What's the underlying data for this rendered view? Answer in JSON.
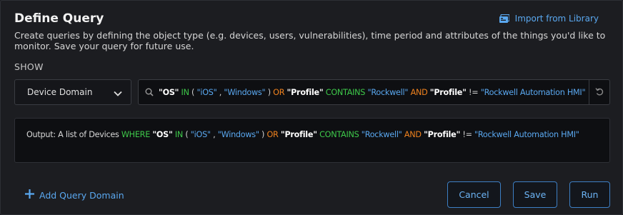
{
  "header": {
    "title": "Define Query",
    "import_label": "Import from Library"
  },
  "description": "Create queries by defining the object type (e.g. devices, users, vulnerabilities), time period and attributes of the things you'd like to monitor. Save your query for future use.",
  "show": {
    "label": "SHOW",
    "selected": "Device Domain"
  },
  "query": {
    "tokens": [
      {
        "t": "\"OS\"",
        "k": "field"
      },
      {
        "t": " IN ",
        "k": "in"
      },
      {
        "t": "( ",
        "k": "paren"
      },
      {
        "t": "\"iOS\"",
        "k": "str"
      },
      {
        "t": " , ",
        "k": "paren"
      },
      {
        "t": "\"Windows\"",
        "k": "str"
      },
      {
        "t": " )  ",
        "k": "paren"
      },
      {
        "t": "OR ",
        "k": "logic"
      },
      {
        "t": "\"Profile\"",
        "k": "field"
      },
      {
        "t": " CONTAINS ",
        "k": "op"
      },
      {
        "t": "\"Rockwell\"",
        "k": "str"
      },
      {
        "t": " AND ",
        "k": "logic"
      },
      {
        "t": "\"Profile\"",
        "k": "field"
      },
      {
        "t": " != ",
        "k": "neq"
      },
      {
        "t": "\"Rockwell Automation HMI\"",
        "k": "str"
      }
    ]
  },
  "output": {
    "prefix": "Output: A list of Devices ",
    "where": "WHERE ",
    "tokens": [
      {
        "t": "\"OS\"",
        "k": "field"
      },
      {
        "t": " IN ",
        "k": "in"
      },
      {
        "t": "( ",
        "k": "paren"
      },
      {
        "t": "\"iOS\"",
        "k": "str"
      },
      {
        "t": " , ",
        "k": "paren"
      },
      {
        "t": "\"Windows\"",
        "k": "str"
      },
      {
        "t": " )  ",
        "k": "paren"
      },
      {
        "t": "OR ",
        "k": "logic"
      },
      {
        "t": "\"Profile\"",
        "k": "field"
      },
      {
        "t": " CONTAINS ",
        "k": "op"
      },
      {
        "t": "\"Rockwell\"",
        "k": "str"
      },
      {
        "t": " AND ",
        "k": "logic"
      },
      {
        "t": "\"Profile\"",
        "k": "field"
      },
      {
        "t": " != ",
        "k": "neq"
      },
      {
        "t": "\"Rockwell Automation HMI\"",
        "k": "str"
      }
    ]
  },
  "footer": {
    "add_domain_label": "Add Query Domain",
    "cancel_label": "Cancel",
    "save_label": "Save",
    "run_label": "Run"
  },
  "colors": {
    "accent": "#5aa8f0",
    "field": "#ffffff",
    "operator": "#3ec94a",
    "logic": "#f0821e",
    "string": "#5aa8f0"
  }
}
